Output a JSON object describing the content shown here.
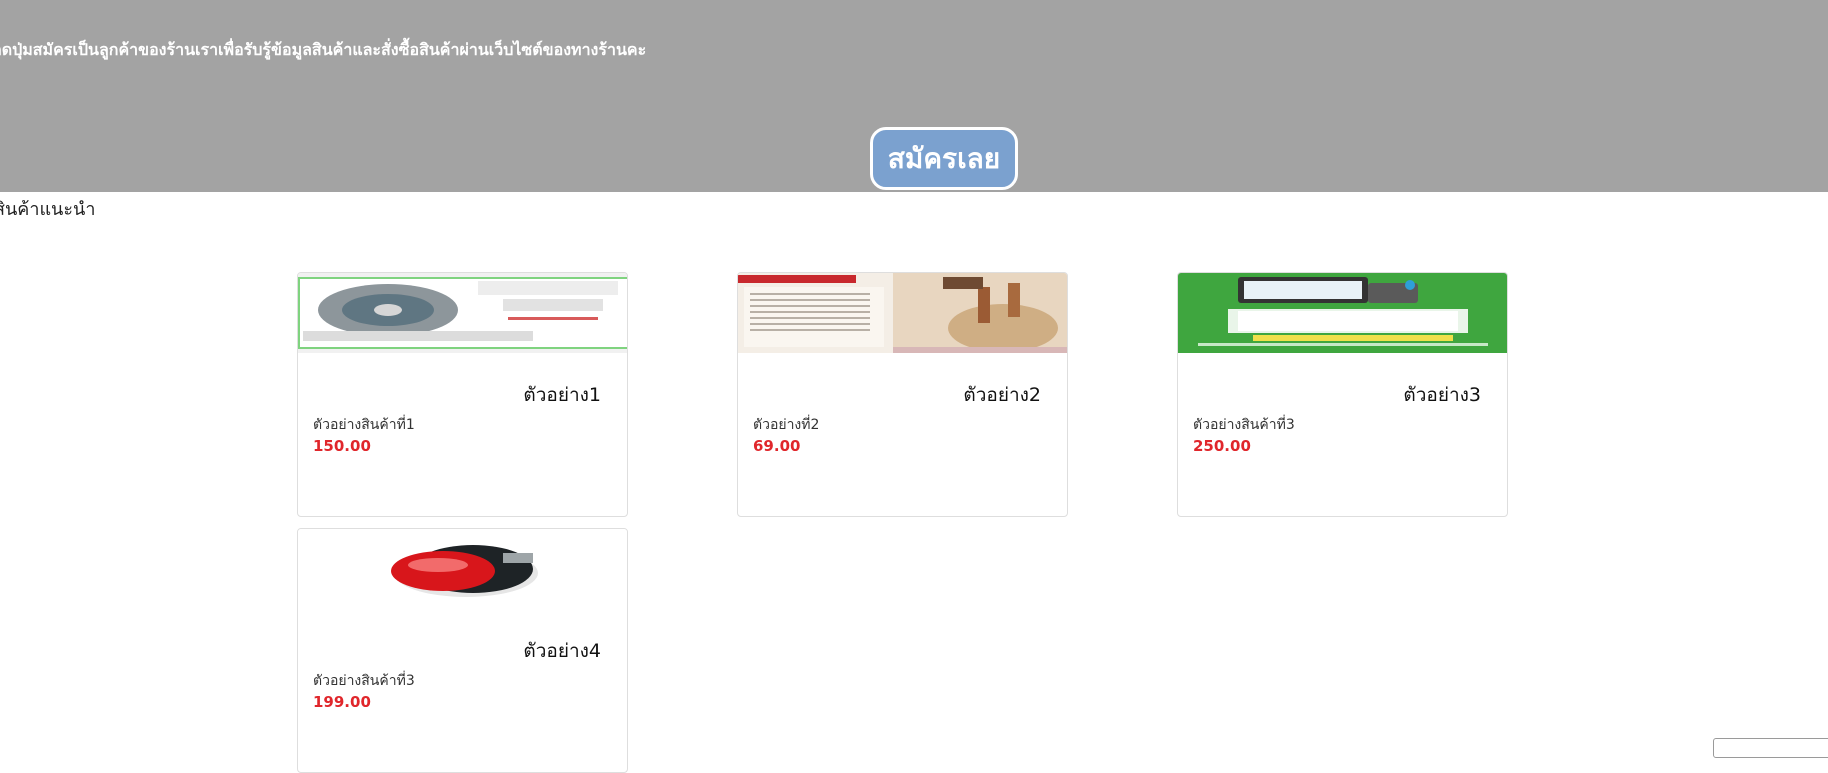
{
  "banner": {
    "text": "กดปุ่มสมัครเป็นลูกค้าของร้านเราเพื่อรับรู้ข้อมูลสินค้าและสั่งซื้อสินค้าผ่านเว็บไซต์ของทางร้านคะ",
    "signup_label": "สมัครเลย"
  },
  "section": {
    "title": "สินค้าแนะนำ"
  },
  "products": [
    {
      "title": "ตัวอย่าง1",
      "description": "ตัวอย่างสินค้าที่1",
      "price": "150.00"
    },
    {
      "title": "ตัวอย่าง2",
      "description": "ตัวอย่างที่2",
      "price": "69.00"
    },
    {
      "title": "ตัวอย่าง3",
      "description": "ตัวอย่างสินค้าที่3",
      "price": "250.00"
    },
    {
      "title": "ตัวอย่าง4",
      "description": "ตัวอย่างสินค้าที่3",
      "price": "199.00"
    }
  ],
  "colors": {
    "banner_bg": "#a3a3a3",
    "button_bg": "#7ba1cf",
    "price": "#e0262b"
  }
}
